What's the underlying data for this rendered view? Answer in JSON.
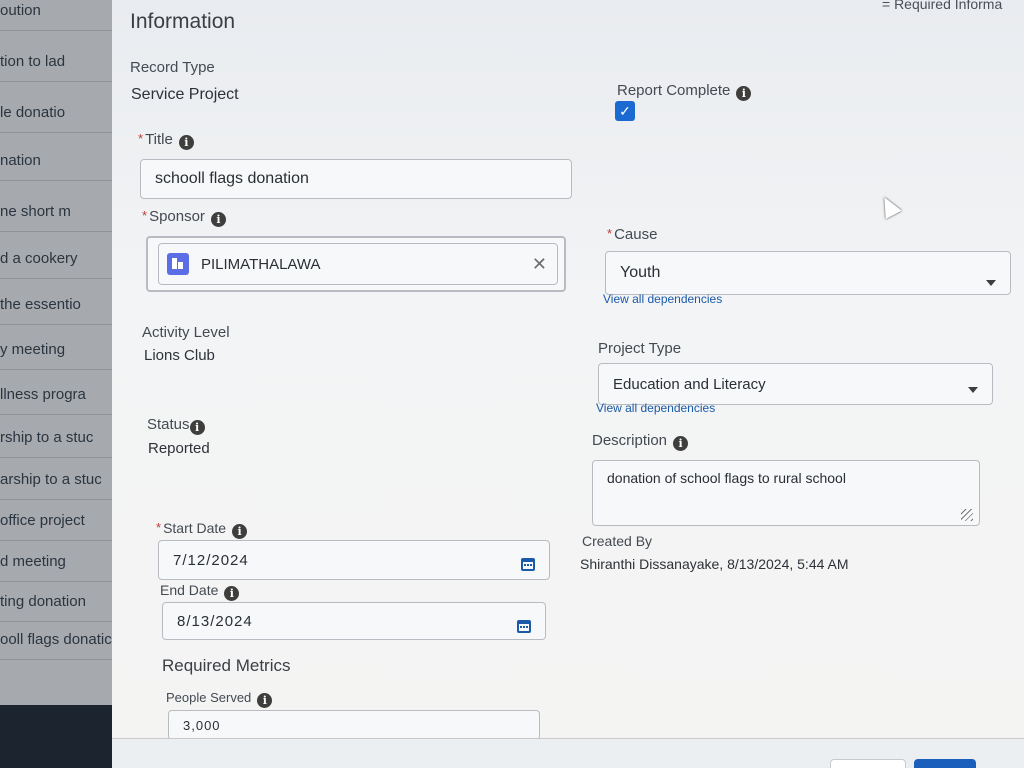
{
  "background_list": {
    "items": [
      "oution",
      "tion to lad",
      "le donatio",
      "nation",
      "ne short m",
      "d a cookery",
      "the essentio",
      "y meeting",
      "llness progra",
      "rship to a stuc",
      "arship to a stuc",
      "office project",
      "d meeting",
      "ting donation",
      "ooll flags donatic"
    ]
  },
  "form": {
    "section_title": "Information",
    "required_note": "= Required Informa",
    "record_type": {
      "label": "Record Type",
      "value": "Service Project"
    },
    "report_complete": {
      "label": "Report Complete",
      "checked": true
    },
    "title": {
      "label": "Title",
      "value": "schooll flags donation"
    },
    "sponsor": {
      "label": "Sponsor",
      "value": "PILIMATHALAWA"
    },
    "cause": {
      "label": "Cause",
      "value": "Youth",
      "link": "View all dependencies"
    },
    "activity_level": {
      "label": "Activity Level",
      "value": "Lions Club"
    },
    "project_type": {
      "label": "Project Type",
      "value": "Education and Literacy",
      "link": "View all dependencies"
    },
    "status": {
      "label": "Status",
      "value": "Reported"
    },
    "description": {
      "label": "Description",
      "value": "donation of school flags to rural school"
    },
    "start_date": {
      "label": "Start Date",
      "value": "7/12/2024"
    },
    "end_date": {
      "label": "End Date",
      "value": "8/13/2024"
    },
    "created_by": {
      "label": "Created By",
      "value": "Shiranthi Dissanayake, 8/13/2024, 5:44 AM"
    },
    "required_metrics": {
      "title": "Required Metrics"
    },
    "people_served": {
      "label": "People Served",
      "value": "3,000"
    }
  },
  "icons": {
    "info": "info-icon",
    "calendar": "calendar-icon",
    "account": "account-icon",
    "clear": "clear-icon",
    "dropdown": "chevron-down-icon",
    "checkbox": "checkmark-icon"
  },
  "colors": {
    "accent": "#1b6ad1",
    "required": "#c23934",
    "link": "#1a5aa8"
  }
}
